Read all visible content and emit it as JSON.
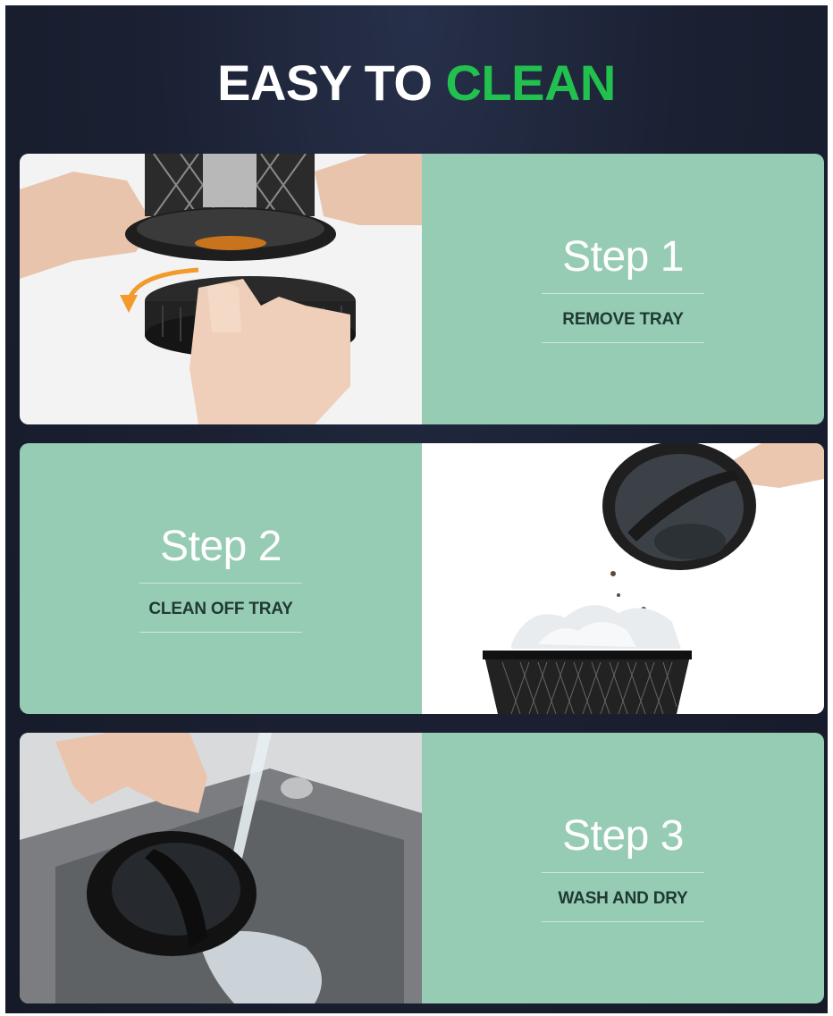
{
  "header": {
    "title_part1": "EASY TO",
    "title_part2": "CLEAN"
  },
  "colors": {
    "accent": "#22c04f",
    "background": "#1b2133",
    "card_green": "#96cbb4"
  },
  "steps": [
    {
      "title": "Step 1",
      "subtitle": "REMOVE TRAY"
    },
    {
      "title": "Step 2",
      "subtitle": "CLEAN OFF TRAY"
    },
    {
      "title": "Step 3",
      "subtitle": "WASH AND DRY"
    }
  ]
}
